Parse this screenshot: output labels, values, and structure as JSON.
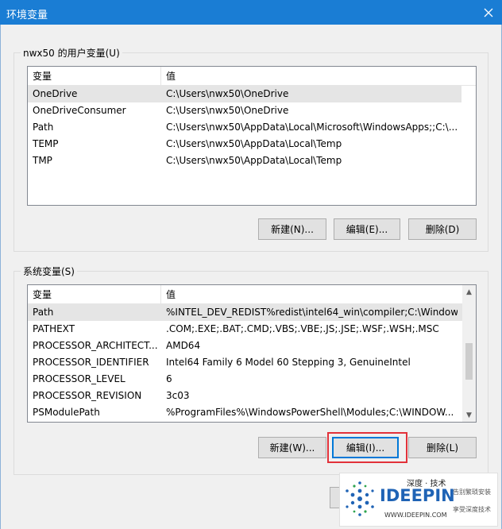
{
  "window": {
    "title": "环境变量"
  },
  "user_vars": {
    "label": "nwx50 的用户变量(U)",
    "columns": [
      "变量",
      "值"
    ],
    "rows": [
      {
        "name": "OneDrive",
        "value": "C:\\Users\\nwx50\\OneDrive"
      },
      {
        "name": "OneDriveConsumer",
        "value": "C:\\Users\\nwx50\\OneDrive"
      },
      {
        "name": "Path",
        "value": "C:\\Users\\nwx50\\AppData\\Local\\Microsoft\\WindowsApps;;C:\\..."
      },
      {
        "name": "TEMP",
        "value": "C:\\Users\\nwx50\\AppData\\Local\\Temp"
      },
      {
        "name": "TMP",
        "value": "C:\\Users\\nwx50\\AppData\\Local\\Temp"
      }
    ],
    "selected_index": 0,
    "buttons": {
      "new": "新建(N)...",
      "edit": "编辑(E)...",
      "delete": "删除(D)"
    }
  },
  "system_vars": {
    "label": "系统变量(S)",
    "columns": [
      "变量",
      "值"
    ],
    "rows": [
      {
        "name": "Path",
        "value": "%INTEL_DEV_REDIST%redist\\intel64_win\\compiler;C:\\Window..."
      },
      {
        "name": "PATHEXT",
        "value": ".COM;.EXE;.BAT;.CMD;.VBS;.VBE;.JS;.JSE;.WSF;.WSH;.MSC"
      },
      {
        "name": "PROCESSOR_ARCHITECT...",
        "value": "AMD64"
      },
      {
        "name": "PROCESSOR_IDENTIFIER",
        "value": "Intel64 Family 6 Model 60 Stepping 3, GenuineIntel"
      },
      {
        "name": "PROCESSOR_LEVEL",
        "value": "6"
      },
      {
        "name": "PROCESSOR_REVISION",
        "value": "3c03"
      },
      {
        "name": "PSModulePath",
        "value": "%ProgramFiles%\\WindowsPowerShell\\Modules;C:\\WINDOW..."
      }
    ],
    "selected_index": 0,
    "buttons": {
      "new": "新建(W)...",
      "edit": "编辑(I)...",
      "delete": "删除(L)"
    }
  },
  "watermark": {
    "cn_title": "深度 · 技术",
    "brand": "IDEEPIN",
    "url": "WWW.IDEEPIN.COM",
    "slogan1": "告别繁琐安装",
    "slogan2": "享受深度技术"
  },
  "colors": {
    "titlebar": "#1a7dd4",
    "highlight": "#e2323a",
    "focus": "#0078d7"
  }
}
